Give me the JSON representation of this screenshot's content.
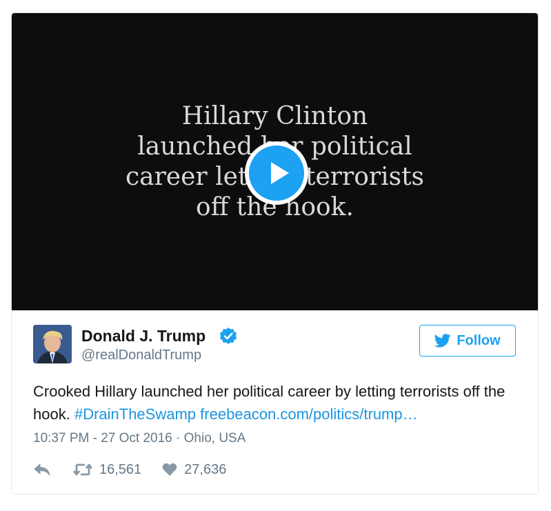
{
  "video": {
    "caption_lines": [
      "Hillary Clinton",
      "launched her political",
      "career letting terrorists",
      "off the hook."
    ]
  },
  "author": {
    "name": "Donald J. Trump",
    "handle": "@realDonaldTrump",
    "verified": true
  },
  "follow_button": {
    "label": "Follow"
  },
  "tweet": {
    "text_plain": "Crooked Hillary launched her political career by letting terrorists off the hook.",
    "hashtag": "#DrainTheSwamp",
    "link": "freebeacon.com/politics/trump…"
  },
  "meta": {
    "time": "10:37 PM - 27 Oct 2016",
    "separator": " · ",
    "location": "Ohio, USA"
  },
  "actions": {
    "retweets": "16,561",
    "likes": "27,636"
  },
  "colors": {
    "accent": "#1da1f2",
    "link": "#1b95e0",
    "text": "#14171a",
    "muted": "#657786",
    "video_bg": "#0d0d0d",
    "border": "#e1e8ed"
  },
  "icons": {
    "play": "play-icon",
    "verified": "verified-badge-icon",
    "bird": "twitter-bird-icon",
    "reply": "reply-icon",
    "retweet": "retweet-icon",
    "like": "heart-icon"
  }
}
